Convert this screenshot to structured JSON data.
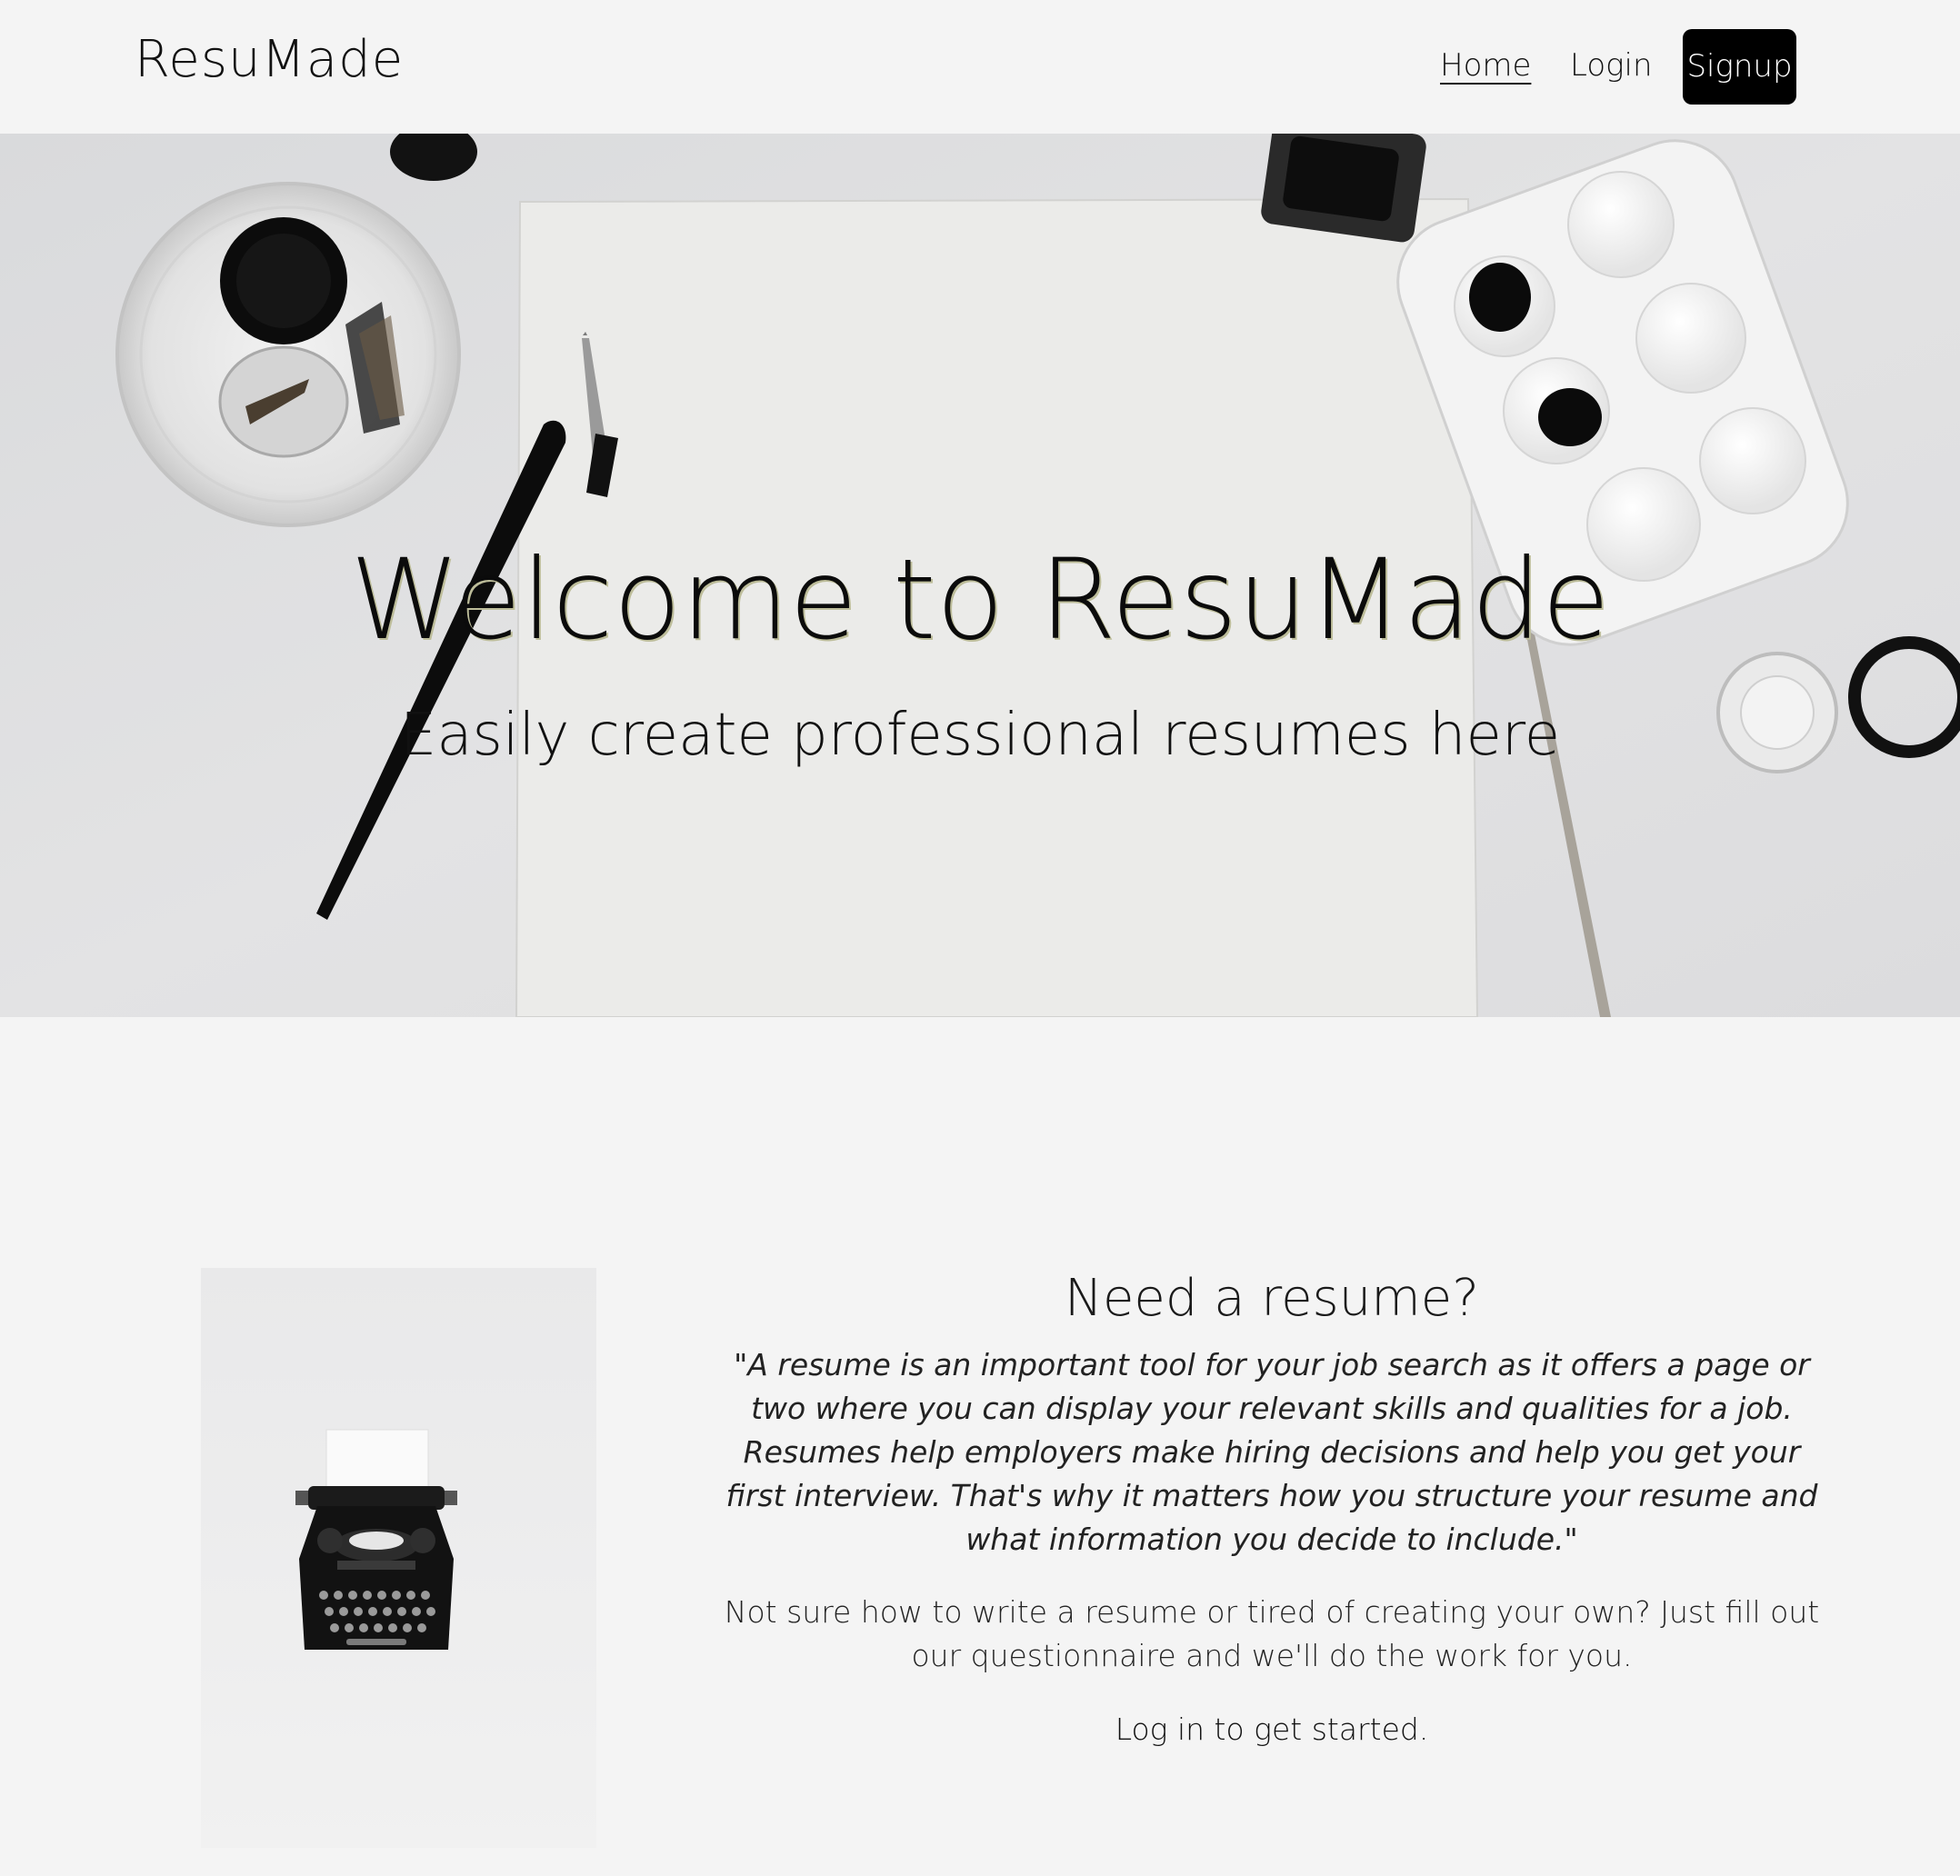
{
  "navbar": {
    "brand": "ResuMade",
    "links": {
      "home": "Home",
      "login": "Login",
      "signup": "Signup"
    }
  },
  "hero": {
    "title": "Welcome to ResuMade",
    "subtitle": "Easily create professional resumes here"
  },
  "about": {
    "heading": "Need a resume?",
    "quote": "\"A resume is an important tool for your job search as it offers a page or two where you can display your relevant skills and qualities for a job. Resumes help employers make hiring decisions and help you get your first interview. That's why it matters how you structure your resume and what information you decide to include.\"",
    "body": "Not sure how to write a resume or tired of creating your own? Just fill out our questionnaire and we'll do the work for you.",
    "cta": "Log in to get started."
  },
  "colors": {
    "page_background": "#f4f4f4",
    "signup_button": "#000000",
    "text": "#111111"
  }
}
